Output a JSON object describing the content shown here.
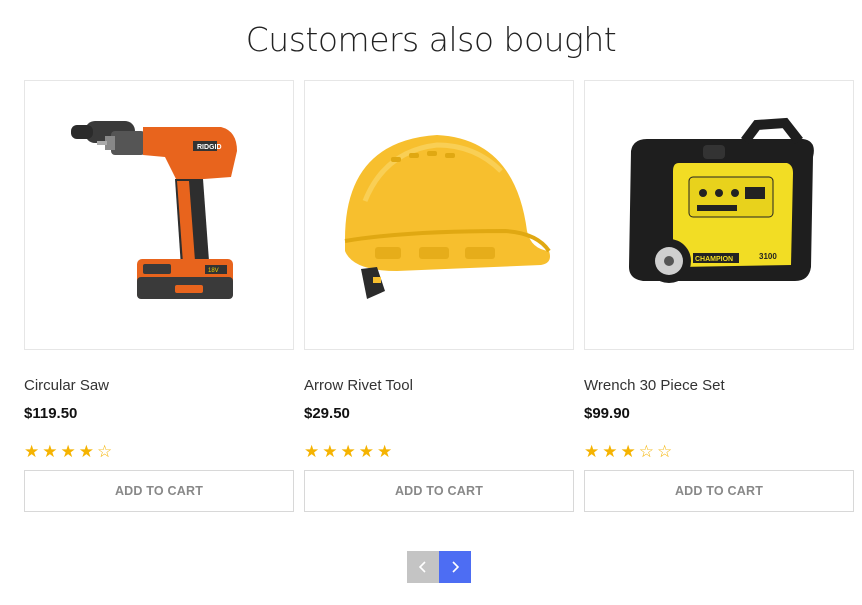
{
  "section": {
    "title": "Customers also bought"
  },
  "products": [
    {
      "name": "Circular Saw",
      "price": "$119.50",
      "rating": 4,
      "image_icon": "cordless-drill-icon",
      "add_to_cart_label": "ADD TO CART"
    },
    {
      "name": "Arrow Rivet Tool",
      "price": "$29.50",
      "rating": 5,
      "image_icon": "hard-hat-icon",
      "add_to_cart_label": "ADD TO CART"
    },
    {
      "name": "Wrench 30 Piece Set",
      "price": "$99.90",
      "rating": 3,
      "image_icon": "generator-icon",
      "add_to_cart_label": "ADD TO CART"
    }
  ],
  "pagination": {
    "prev_icon": "chevron-left-icon",
    "next_icon": "chevron-right-icon"
  },
  "colors": {
    "star": "#f5b301",
    "pager_prev_bg": "#c4c4c4",
    "pager_next_bg": "#4d6df3"
  }
}
